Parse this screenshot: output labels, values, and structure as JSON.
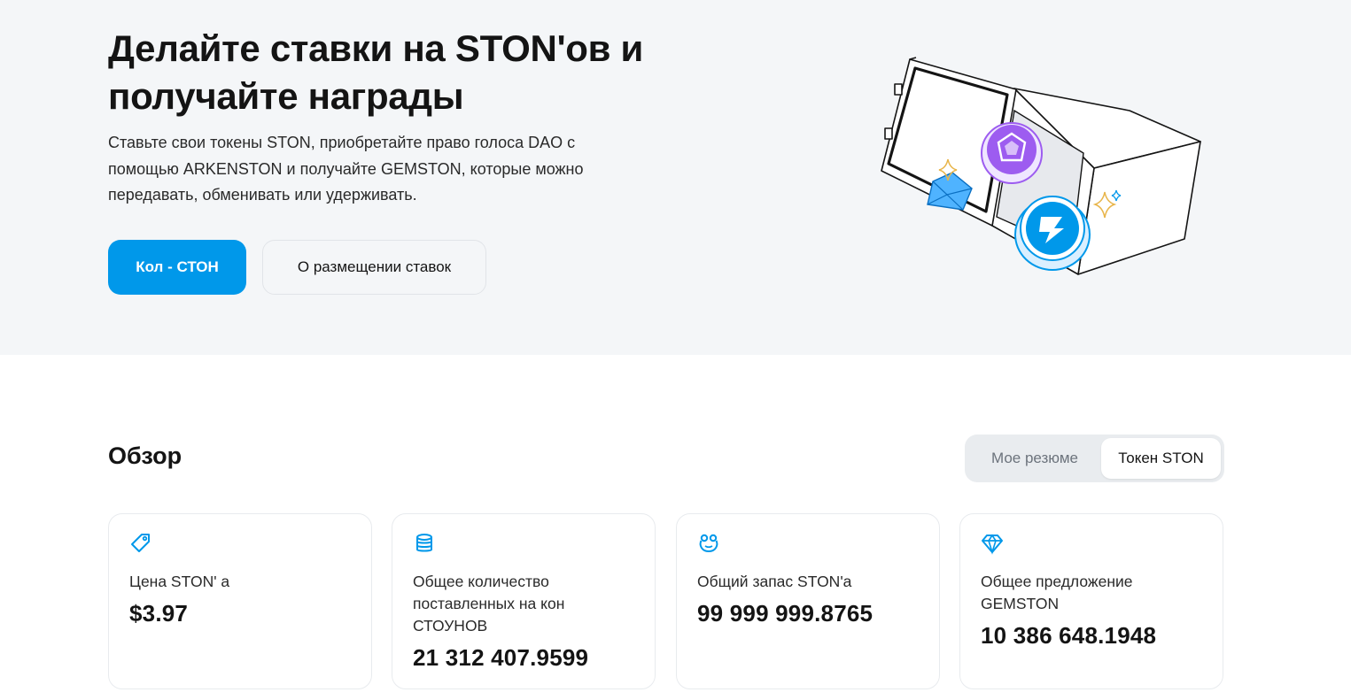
{
  "hero": {
    "title": "Делайте ставки на STON'ов и получайте награды",
    "description": "Ставьте свои токены STON, приобретайте право голоса DAO с помощью ARKENSTON и получайте GEMSTON, которые можно передавать, обменивать или удерживать.",
    "primary_button": "Кол - СТОН",
    "secondary_button": "О размещении ставок"
  },
  "overview": {
    "title": "Обзор",
    "tabs": [
      "Мое резюме",
      "Токен STON"
    ],
    "active_tab": "Токен STON"
  },
  "cards": [
    {
      "icon": "price-tag-icon",
      "label": "Цена STON' а",
      "value": "$3.97"
    },
    {
      "icon": "coin-stack-icon",
      "label": "Общее количество поставленных на кон СТОУНОВ",
      "value": "21 312 407.9599"
    },
    {
      "icon": "frog-icon",
      "label": "Общий запас STON'а",
      "value": "99 999 999.8765"
    },
    {
      "icon": "diamond-icon",
      "label": "Общее предложение GEMSTON",
      "value": "10 386 648.1948"
    }
  ],
  "colors": {
    "accent": "#0098ea",
    "hero_background": "#f4f6f8",
    "gem_purple": "#9d5cf0"
  }
}
